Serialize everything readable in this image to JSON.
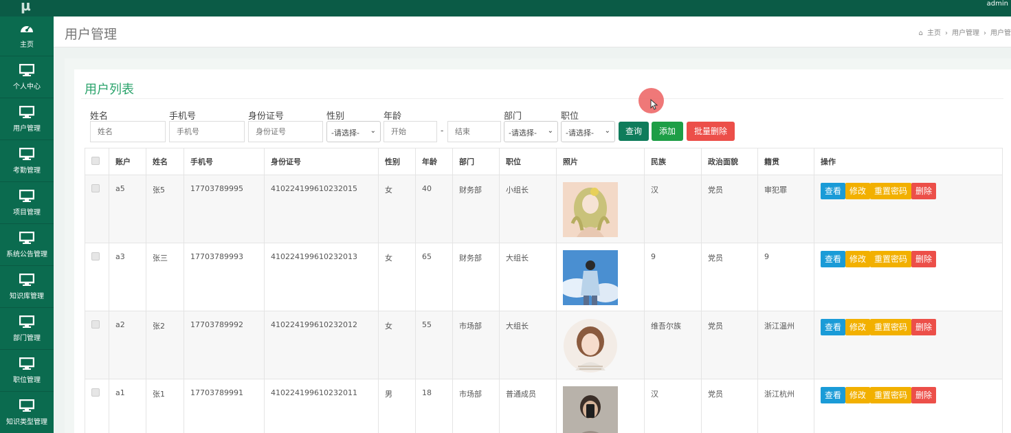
{
  "app": {
    "logo": "μ",
    "user": "admin"
  },
  "sidebar": {
    "items": [
      {
        "label": "主页",
        "icon": "dashboard-icon"
      },
      {
        "label": "个人中心",
        "icon": "monitor-icon"
      },
      {
        "label": "用户管理",
        "icon": "monitor-icon"
      },
      {
        "label": "考勤管理",
        "icon": "monitor-icon"
      },
      {
        "label": "项目管理",
        "icon": "monitor-icon"
      },
      {
        "label": "系统公告管理",
        "icon": "monitor-icon"
      },
      {
        "label": "知识库管理",
        "icon": "monitor-icon"
      },
      {
        "label": "部门管理",
        "icon": "monitor-icon"
      },
      {
        "label": "职位管理",
        "icon": "monitor-icon"
      },
      {
        "label": "知识类型管理",
        "icon": "monitor-icon"
      }
    ]
  },
  "header": {
    "title": "用户管理",
    "breadcrumb": [
      "主页",
      "›",
      "用户管理",
      "›",
      "用户管"
    ]
  },
  "list": {
    "title": "用户列表"
  },
  "filters": {
    "name_label": "姓名",
    "name_placeholder": "姓名",
    "phone_label": "手机号",
    "phone_placeholder": "手机号",
    "id_label": "身份证号",
    "id_placeholder": "身份证号",
    "gender_label": "性别",
    "gender_value": "-请选择-",
    "age_label": "年龄",
    "age_start_placeholder": "开始",
    "age_dash": "-",
    "age_end_placeholder": "结束",
    "dept_label": "部门",
    "dept_value": "-请选择-",
    "position_label": "职位",
    "position_value": "-请选择-",
    "search_button": "查询",
    "add_button": "添加",
    "batch_delete_button": "批量删除"
  },
  "table": {
    "columns": [
      "",
      "账户",
      "姓名",
      "手机号",
      "身份证号",
      "性别",
      "年龄",
      "部门",
      "职位",
      "照片",
      "民族",
      "政治面貌",
      "籍贯",
      "操作"
    ],
    "rows": [
      {
        "account": "a5",
        "name": "张5",
        "phone": "17703789995",
        "id_number": "410224199610232015",
        "gender": "女",
        "age": "40",
        "dept": "财务部",
        "position": "小组长",
        "photo": "anime-girl-photo",
        "ethnicity": "汉",
        "political": "党员",
        "hometown": "审犯罪"
      },
      {
        "account": "a3",
        "name": "张三",
        "phone": "17703789993",
        "id_number": "410224199610232013",
        "gender": "女",
        "age": "65",
        "dept": "财务部",
        "position": "大组长",
        "photo": "sky-boy-photo",
        "ethnicity": "9",
        "political": "党员",
        "hometown": "9"
      },
      {
        "account": "a2",
        "name": "张2",
        "phone": "17703789992",
        "id_number": "410224199610232012",
        "gender": "女",
        "age": "55",
        "dept": "市场部",
        "position": "大组长",
        "photo": "girl-portrait-photo",
        "ethnicity": "维吾尔族",
        "political": "党员",
        "hometown": "浙江温州"
      },
      {
        "account": "a1",
        "name": "张1",
        "phone": "17703789991",
        "id_number": "410224199610232011",
        "gender": "男",
        "age": "18",
        "dept": "市场部",
        "position": "普通成员",
        "photo": "selfie-photo",
        "ethnicity": "汉",
        "political": "党员",
        "hometown": "浙江杭州"
      }
    ],
    "actions": {
      "view": "查看",
      "edit": "修改",
      "reset": "重置密码",
      "delete": "删除"
    }
  },
  "colors": {
    "sidebar": "#0b6b4f",
    "topbar": "#0b5b46",
    "title_green": "#2aa36b",
    "view": "#1a9bd7",
    "edit": "#f2b000",
    "delete": "#ec4f49",
    "search": "#0f7c5b",
    "add": "#1e9e46"
  }
}
